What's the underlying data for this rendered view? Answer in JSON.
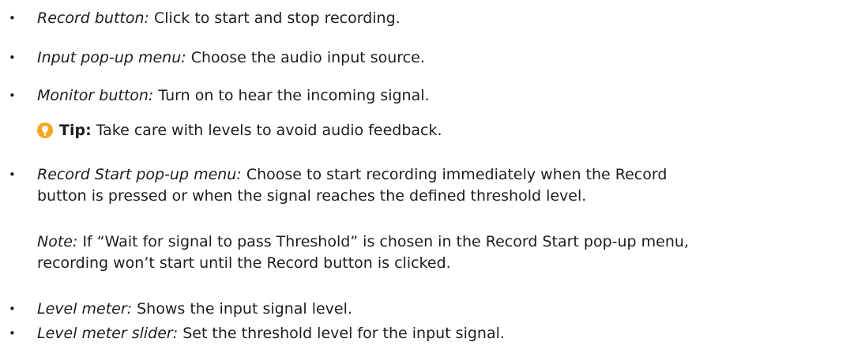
{
  "items": [
    {
      "term": "Record button:",
      "text": "Click to start and stop recording."
    },
    {
      "term": "Input pop-up menu:",
      "text": "Choose the audio input source."
    },
    {
      "term": "Monitor button:",
      "text": "Turn on to hear the incoming signal."
    },
    {
      "term": "Record Start pop-up menu:",
      "text_line1": "Choose to start recording immediately when the Record",
      "text_line2": "button is pressed or when the signal reaches the defined threshold level."
    },
    {
      "term": "Level meter:",
      "text": "Shows the input signal level."
    },
    {
      "term": "Level meter slider:",
      "text": "Set the threshold level for the input signal."
    }
  ],
  "tip": {
    "label": "Tip:",
    "text": "Take care with levels to avoid audio feedback.",
    "icon": "lightbulb-icon",
    "icon_color": "#f5a623"
  },
  "note": {
    "label": "Note:",
    "line1": "If “Wait for signal to pass Threshold” is chosen in the Record Start pop-up menu,",
    "line2": "recording won’t start until the Record button is clicked."
  },
  "bullet_char": "•"
}
